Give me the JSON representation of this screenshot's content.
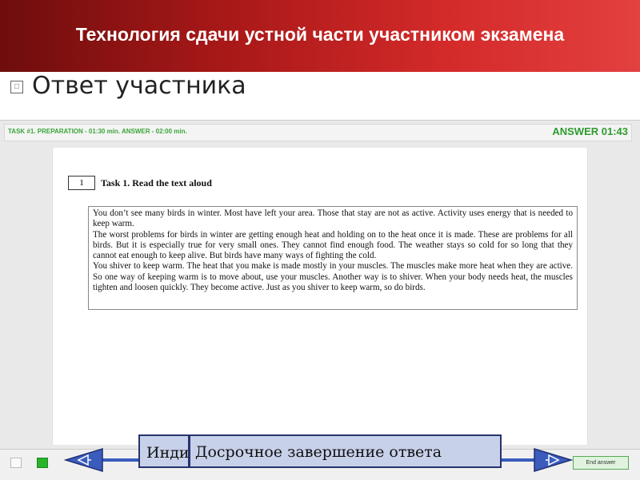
{
  "header": {
    "title": "Технология сдачи устной части участником экзамена"
  },
  "slide": {
    "subtitle": "Ответ участника"
  },
  "exam": {
    "task_info": "TASK #1.  PREPARATION - 01:30 min. ANSWER - 02:00 min.",
    "timer": "ANSWER 01:43",
    "task_number": "1",
    "task_title": "Task 1. Read the text aloud",
    "paragraphs": [
      "You don’t see many birds in winter. Most have left your area. Those that stay are not as active. Activity uses energy that is needed to keep warm.",
      "The worst problems for birds in winter are getting enough heat and holding on to the heat once it is made. These are problems for all birds. But it is especially true for very small ones. They cannot find enough food. The weather stays so cold for so long that they cannot eat enough to keep alive. But birds have many ways of fighting the cold.",
      "You shiver to keep warm.  The heat that you make is made mostly in your muscles. The muscles make more heat when they are active. So one way of keeping warm is to move about, use your muscles. Another way is to shiver. When your body needs heat, the muscles tighten and loosen quickly. They become active. Just as you shiver to keep warm, so do birds."
    ],
    "end_answer_label": "End answer"
  },
  "callouts": {
    "hidden_label": "Инди",
    "early_finish": "Досрочное завершение ответа"
  },
  "icons": {
    "bullet": "bullet-icon",
    "prev": "left-arrow-icon",
    "next": "right-arrow-icon"
  },
  "colors": {
    "header_red": "#c21f1f",
    "timer_green": "#2e9b2e",
    "arrow_blue": "#3b5cbd",
    "callout_fill": "#c8d1ea"
  }
}
